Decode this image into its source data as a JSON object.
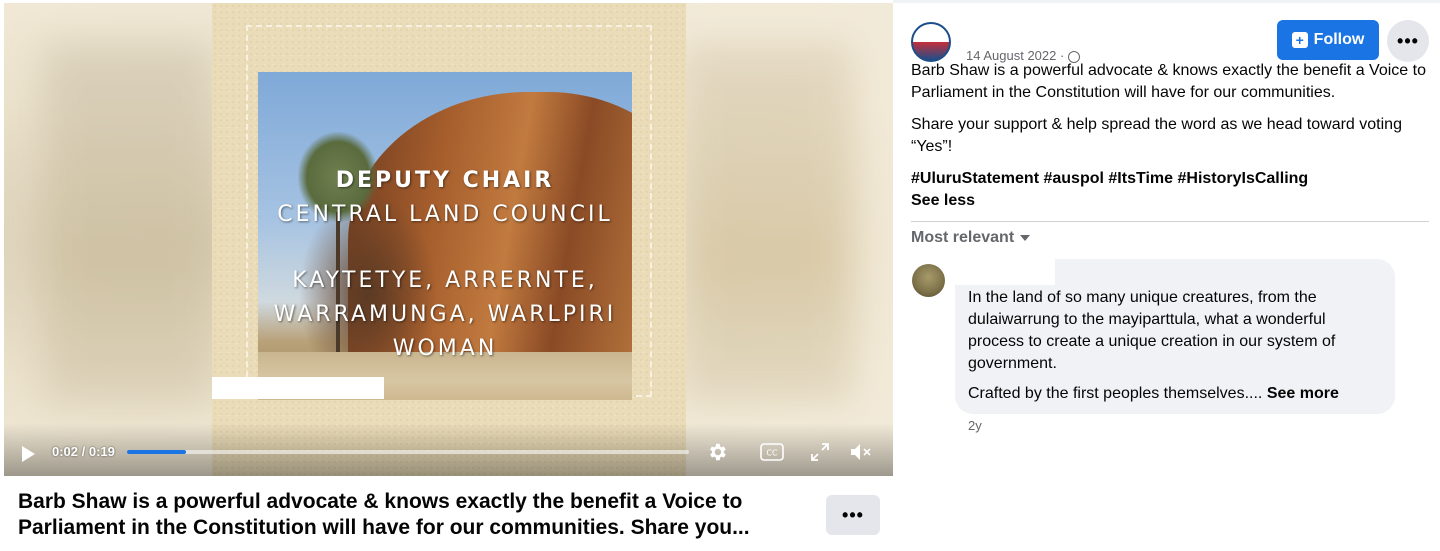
{
  "video": {
    "overlay_lines": [
      "DEPUTY CHAIR",
      "CENTRAL LAND COUNCIL",
      "KAYTETYE, ARRERNTE,",
      "WARRAMUNGA, WARLPIRI",
      "WOMAN"
    ],
    "time_display": "0:02 / 0:19",
    "progress_percent": 10.5,
    "cc_label": "CC",
    "title": "Barb Shaw is a powerful advocate & knows exactly the benefit a Voice to Parliament in the Constitution will have for our communities. Share you...",
    "more_label": "•••"
  },
  "post": {
    "date": "14 August 2022 ·",
    "follow_label": "Follow",
    "more_label": "•••",
    "paragraph1": "Barb Shaw is a powerful advocate & knows exactly the benefit a Voice to Parliament in the Constitution will have for our communities.",
    "paragraph2": "Share your support & help spread the word as we head toward voting “Yes”!",
    "hashtags": [
      "#UluruStatement",
      "#auspol",
      "#ItsTime",
      "#HistoryIsCalling"
    ],
    "see_less": "See less"
  },
  "comments": {
    "sort_label": "Most relevant",
    "items": [
      {
        "text1": "In the land of so many unique creatures, from the dulaiwarrung to the mayiparttula, what a wonderful process to create a unique creation in our system of government.",
        "text2": "Crafted by the first peoples themselves....",
        "see_more": "See more",
        "time": "2y"
      }
    ]
  },
  "colors": {
    "accent": "#1b74e4",
    "secondary_button": "#e4e6eb",
    "comment_bubble": "#f0f2f5",
    "muted_text": "#65676b"
  }
}
